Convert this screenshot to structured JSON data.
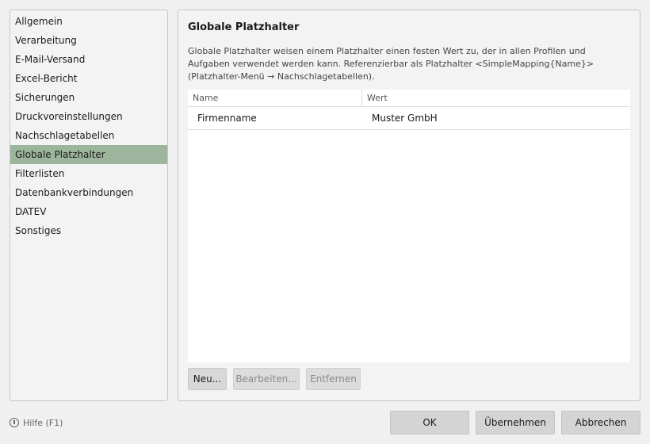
{
  "sidebar": {
    "items": [
      {
        "label": "Allgemein"
      },
      {
        "label": "Verarbeitung"
      },
      {
        "label": "E-Mail-Versand"
      },
      {
        "label": "Excel-Bericht"
      },
      {
        "label": "Sicherungen"
      },
      {
        "label": "Druckvoreinstellungen"
      },
      {
        "label": "Nachschlagetabellen"
      },
      {
        "label": "Globale Platzhalter"
      },
      {
        "label": "Filterlisten"
      },
      {
        "label": "Datenbankverbindungen"
      },
      {
        "label": "DATEV"
      },
      {
        "label": "Sonstiges"
      }
    ],
    "selected": "Globale Platzhalter",
    "selected_color": "#9cb59c"
  },
  "panel": {
    "title": "Globale Platzhalter",
    "description": "Globale Platzhalter weisen einem Platzhalter einen festen Wert zu, der in allen Profilen und Aufgaben verwendet werden kann. Referenzierbar als Platzhalter <SimpleMapping{Name}> (Platzhalter-Menü → Nachschlagetabellen).",
    "table": {
      "columns": [
        "Name",
        "Wert"
      ],
      "rows": [
        {
          "name": "Firmenname",
          "value": "Muster GmbH"
        }
      ]
    },
    "buttons": {
      "new": "Neu...",
      "edit": "Bearbeiten...",
      "remove": "Entfernen"
    }
  },
  "footer": {
    "help_label": "Hilfe (F1)",
    "help_icon": "help-circle-icon",
    "ok_label": "OK",
    "apply_label": "Übernehmen",
    "cancel_label": "Abbrechen"
  }
}
